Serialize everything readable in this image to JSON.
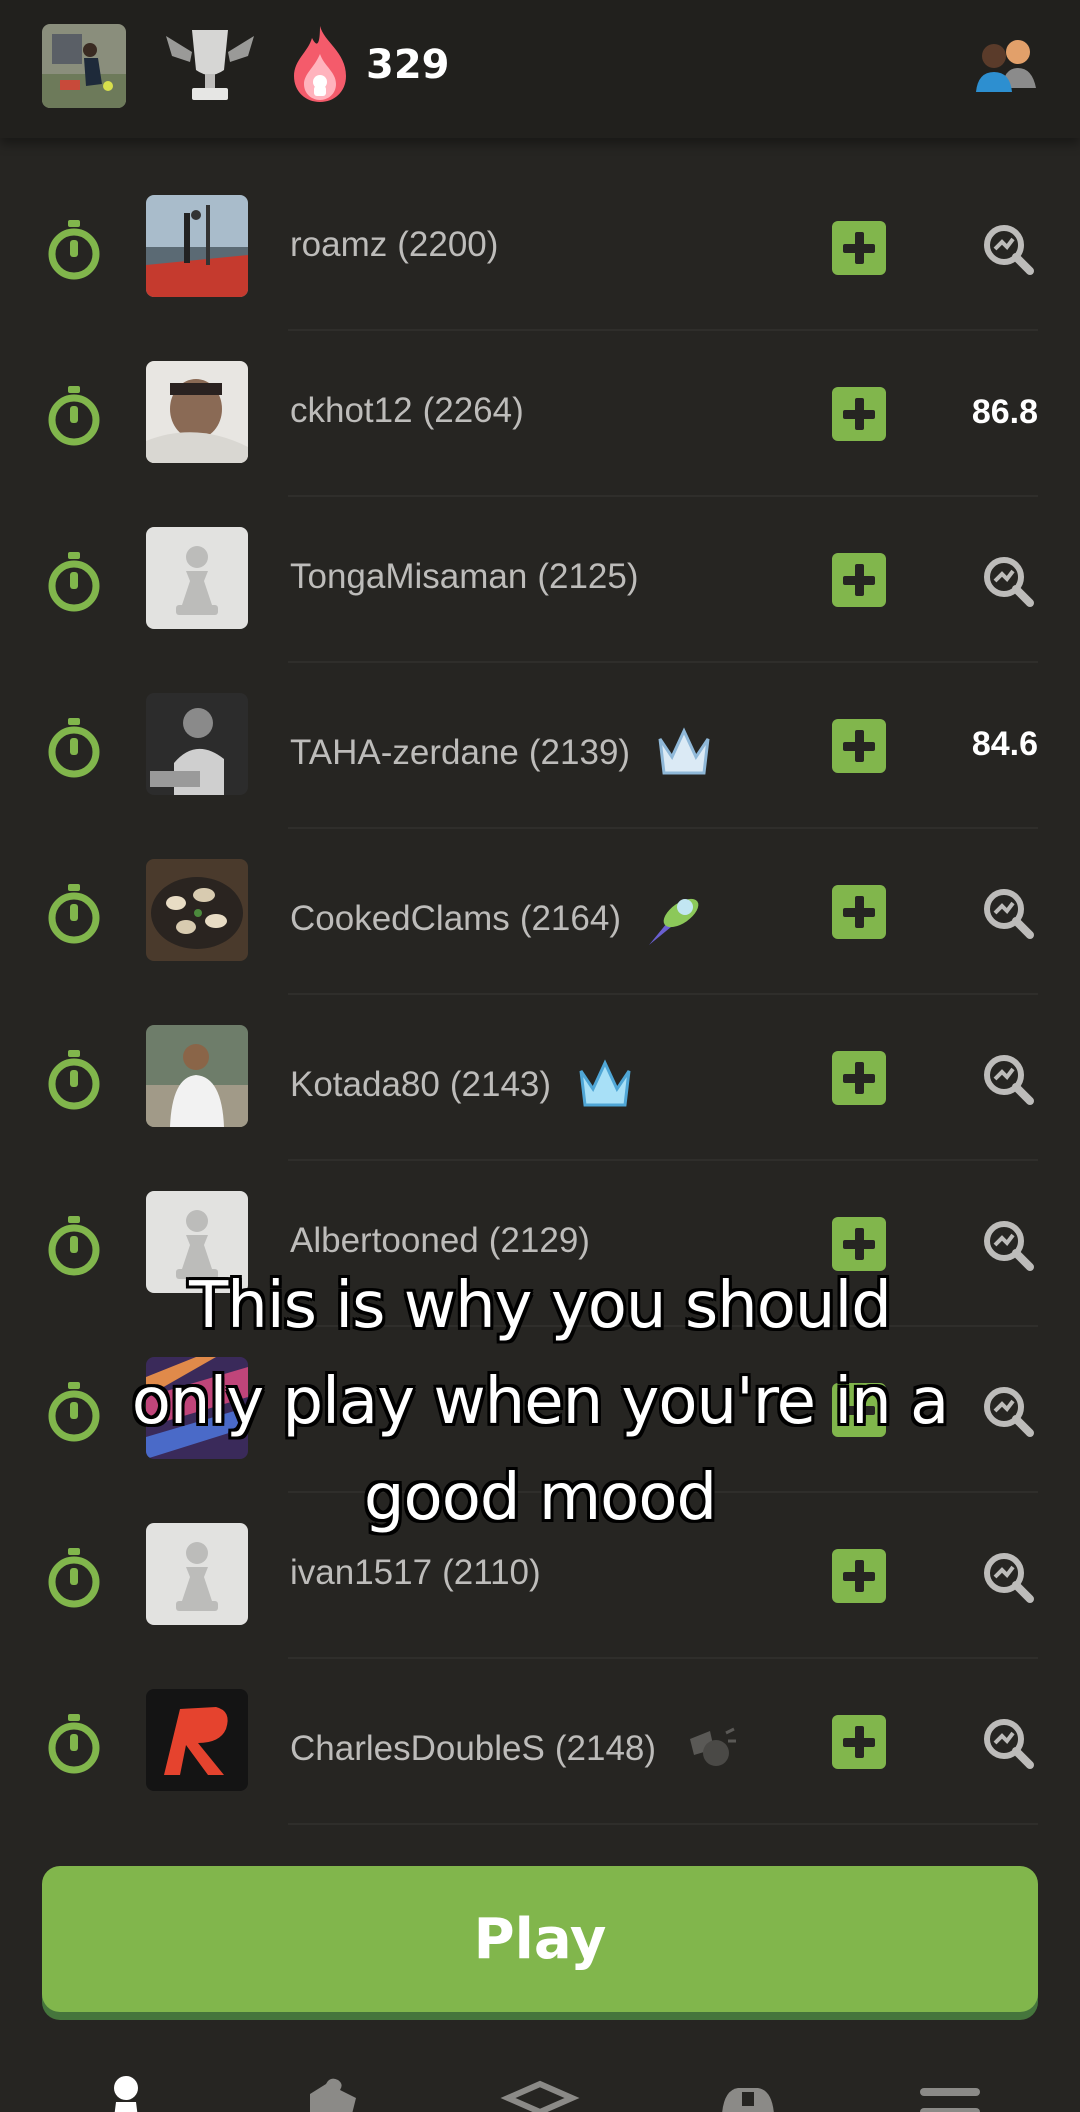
{
  "header": {
    "streak_count": "329",
    "icons": [
      "user-avatar",
      "trophy-icon",
      "flame-icon",
      "friends-icon"
    ]
  },
  "players": [
    {
      "name": "roamz",
      "rating": "(2200)",
      "badge": null,
      "right": "zoom"
    },
    {
      "name": "ckhot12",
      "rating": "(2264)",
      "badge": null,
      "right": "86.8"
    },
    {
      "name": "TongaMisaman",
      "rating": "(2125)",
      "badge": null,
      "right": "zoom"
    },
    {
      "name": "TAHA-zerdane",
      "rating": "(2139)",
      "badge": "crown-icon",
      "right": "84.6"
    },
    {
      "name": "CookedClams",
      "rating": "(2164)",
      "badge": "ufo-icon",
      "right": "zoom"
    },
    {
      "name": "Kotada80",
      "rating": "(2143)",
      "badge": "crown-icon",
      "right": "zoom"
    },
    {
      "name": "Albertooned",
      "rating": "(2129)",
      "badge": null,
      "right": "zoom"
    },
    {
      "name": "",
      "rating": "",
      "badge": null,
      "right": "zoom"
    },
    {
      "name": "ivan1517",
      "rating": "(2110)",
      "badge": null,
      "right": "zoom"
    },
    {
      "name": "CharlesDoubleS",
      "rating": "(2148)",
      "badge": "cheering-icon",
      "right": "zoom"
    }
  ],
  "caption": {
    "line1": "This is why you should",
    "line2": "only play when you're in a",
    "line3": "good mood"
  },
  "play_button": {
    "label": "Play"
  },
  "nav": {
    "items": [
      "play-pawn-icon",
      "puzzle-icon",
      "learn-icon",
      "watch-icon",
      "menu-icon"
    ]
  },
  "colors": {
    "accent_green": "#81b64c",
    "background": "#262522",
    "text": "#bdbcba"
  }
}
